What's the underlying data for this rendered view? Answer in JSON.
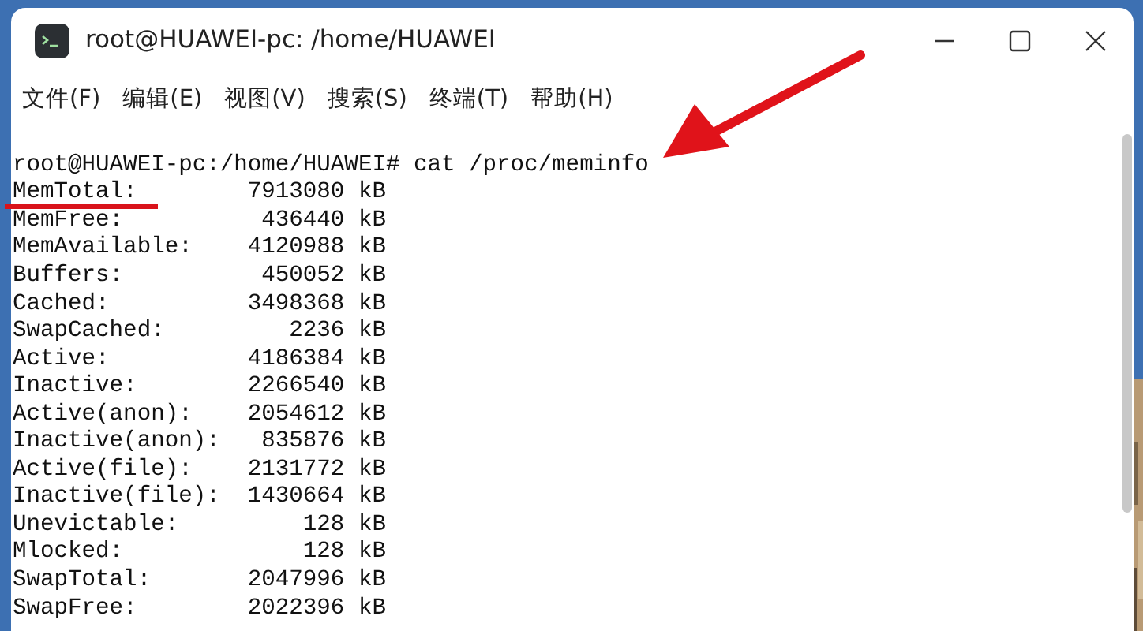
{
  "window": {
    "title": "root@HUAWEI-pc: /home/HUAWEI"
  },
  "menu": [
    "文件(F)",
    "编辑(E)",
    "视图(V)",
    "搜索(S)",
    "终端(T)",
    "帮助(H)"
  ],
  "terminal": {
    "prompt": "root@HUAWEI-pc:/home/HUAWEI# cat /proc/meminfo",
    "lines": [
      "MemTotal:        7913080 kB",
      "MemFree:          436440 kB",
      "MemAvailable:    4120988 kB",
      "Buffers:          450052 kB",
      "Cached:          3498368 kB",
      "SwapCached:         2236 kB",
      "Active:          4186384 kB",
      "Inactive:        2266540 kB",
      "Active(anon):    2054612 kB",
      "Inactive(anon):   835876 kB",
      "Active(file):    2131772 kB",
      "Inactive(file):  1430664 kB",
      "Unevictable:         128 kB",
      "Mlocked:             128 kB",
      "SwapTotal:       2047996 kB",
      "SwapFree:        2022396 kB"
    ]
  }
}
